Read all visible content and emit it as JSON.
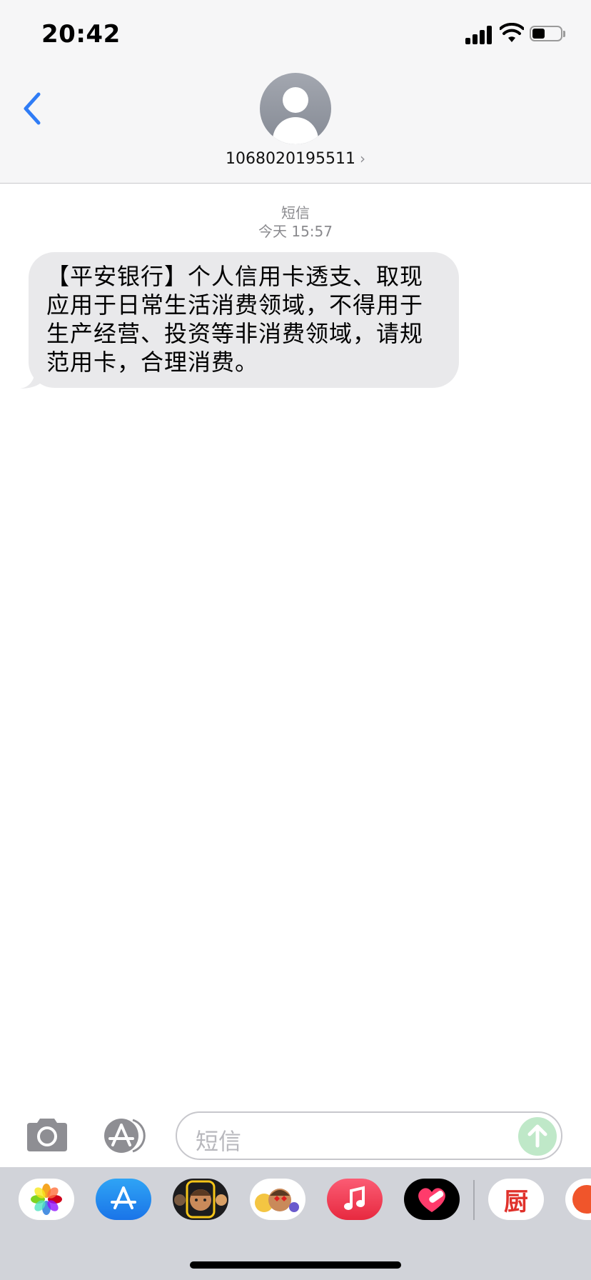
{
  "status_bar": {
    "time": "20:42",
    "signal_icon": "cellular-signal-icon",
    "wifi_icon": "wifi-icon",
    "battery_icon": "battery-icon",
    "battery_level": 0.45
  },
  "header": {
    "back_icon": "chevron-left-icon",
    "avatar_icon": "person-avatar-icon",
    "contact_name": "1068020195511",
    "chevron": "›"
  },
  "conversation": {
    "service_label": "短信",
    "timestamp": "今天 15:57",
    "messages": [
      {
        "direction": "incoming",
        "text": "【平安银行】个人信用卡透支、取现应用于日常生活消费领域，不得用于生产经营、投资等非消费领域，请规范用卡，合理消费。"
      }
    ]
  },
  "composer": {
    "camera_icon": "camera-icon",
    "apps_icon": "app-store-icon",
    "placeholder": "短信",
    "send_icon": "arrow-up-icon"
  },
  "app_drawer": {
    "apps": [
      {
        "name": "photos-app-icon"
      },
      {
        "name": "app-store-app-icon"
      },
      {
        "name": "memoji-app-icon"
      },
      {
        "name": "animoji-stickers-app-icon"
      },
      {
        "name": "music-app-icon"
      },
      {
        "name": "heart-sticker-app-icon"
      },
      {
        "name": "kitchen-app-icon",
        "label": "厨"
      },
      {
        "name": "partial-app-icon"
      }
    ]
  },
  "colors": {
    "accent": "#2f7cf6",
    "bubble_incoming": "#e9e9eb",
    "header_bg": "#f6f6f7",
    "drawer_bg": "#d1d3d9"
  }
}
